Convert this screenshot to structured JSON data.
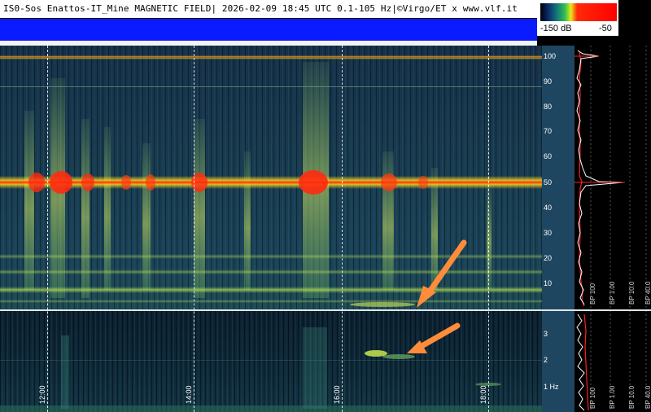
{
  "header": {
    "title": "IS0-Sos Enattos-IT_Mine MAGNETIC FIELD| 2026-02-09 18:45 UTC 0.1-105 Hz|©Virgo/ET x www.vlf.it"
  },
  "color_scale": {
    "min_label": "-150 dB",
    "max_label": "-50",
    "colors": [
      "#000000",
      "#0b2a6a",
      "#137a7a",
      "#2fbf4f",
      "#e8e81a",
      "#ff2a0a",
      "#ff0000"
    ]
  },
  "upper_axis": {
    "ticks": [
      "100",
      "90",
      "80",
      "70",
      "60",
      "50",
      "40",
      "30",
      "20",
      "10"
    ]
  },
  "lower_axis": {
    "ticks": [
      "3",
      "2",
      "1 Hz"
    ]
  },
  "time_axis": {
    "ticks": [
      "12:00",
      "14:00",
      "16:00",
      "18:00"
    ]
  },
  "side_plot": {
    "labels": [
      "BP 100",
      "BP 1.00",
      "BP 10.0",
      "BP 40.0",
      "BP 100",
      "BP 1.00",
      "BP 10.0",
      "BP 40.0"
    ],
    "colors": {
      "trace_white": "#ffffff",
      "trace_red": "#ff2020",
      "grid": "#555555"
    }
  },
  "annotations": {
    "arrow_color": "#ff8c3a"
  }
}
